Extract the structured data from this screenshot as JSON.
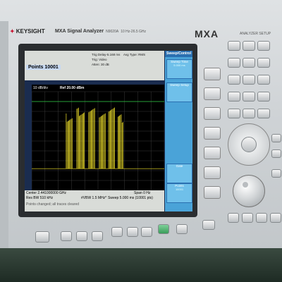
{
  "instrument": {
    "brand": "KEYSIGHT",
    "model": "MXA Signal Analyzer",
    "model_number": "N9020A",
    "freq_range": "10 Hz-26.5 GHz",
    "series": "MXA",
    "panel_label": "ANALYZER SETUP"
  },
  "screen": {
    "points_label": "Points 10001",
    "header_lines": [
      "Trig Delay-5.168 ms",
      "Trig: Video",
      "Atten: 30 dB",
      "Avg Type: RMS"
    ],
    "ref_level": "Ref 20.00 dBm",
    "scale": "10 dB/div",
    "center_freq": "Center 2.441000000 GHz",
    "res_bw": "Res BW 510 kHz",
    "vbw": "#VBW 1.5 MHz*",
    "span": "Span 0 Hz",
    "sweep": "Sweep  5.000 ms (10001 pts)",
    "status": "Points changed; all traces cleared"
  },
  "softmenu": {
    "title": "Sweep/Control",
    "keys": [
      {
        "label": "Sweep Time",
        "value": "5.000 ms"
      },
      {
        "label": "Sweep Setup",
        "value": ""
      },
      {
        "label": "Gate",
        "value": "Off  Setup"
      },
      {
        "label": "Points",
        "value": "10001"
      }
    ]
  },
  "colors": {
    "trace": "#f5e52a",
    "grid": "#3a3a3a",
    "display_line": "#2ecc40",
    "menu": "#4aa3d8"
  },
  "chart_data": {
    "type": "line",
    "title": "",
    "xlabel": "",
    "ylabel": "",
    "ylim": [
      -80,
      20
    ],
    "bursts": [
      {
        "start": 0.26,
        "end": 0.31,
        "level": -2
      },
      {
        "start": 0.34,
        "end": 0.4,
        "level": 4
      },
      {
        "start": 0.43,
        "end": 0.48,
        "level": 6
      },
      {
        "start": 0.51,
        "end": 0.56,
        "level": 2
      },
      {
        "start": 0.58,
        "end": 0.63,
        "level": 5
      },
      {
        "start": 0.65,
        "end": 0.69,
        "level": -3
      }
    ],
    "noise_floor": -58,
    "grid": true
  }
}
